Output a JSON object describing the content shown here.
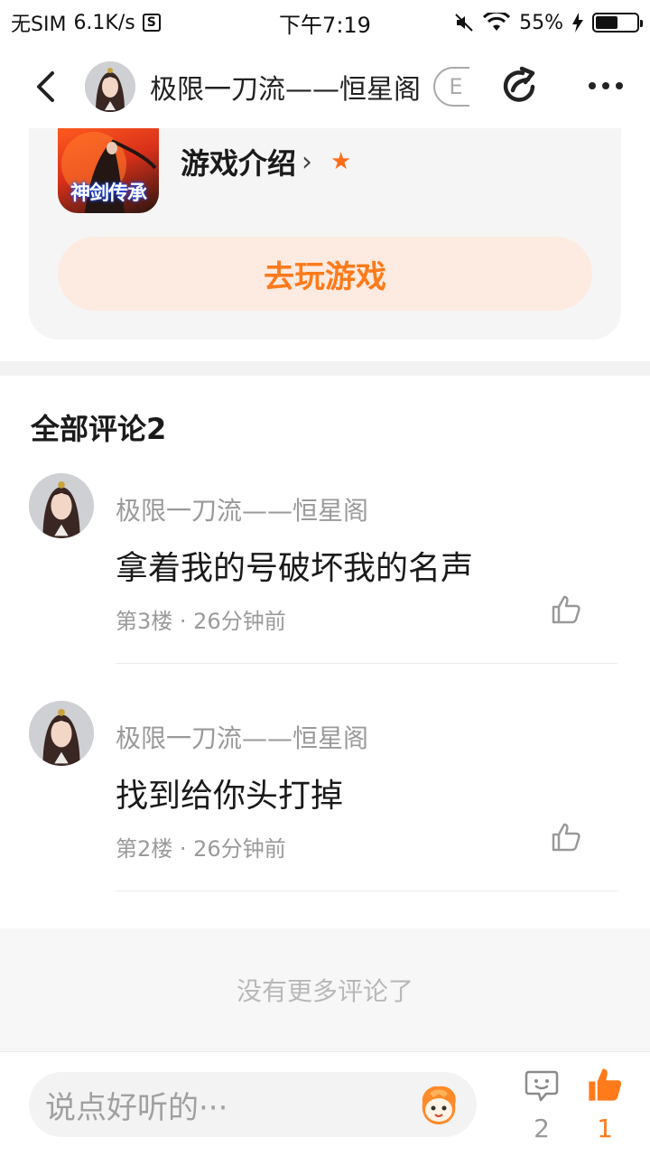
{
  "status_bar": {
    "carrier": "无SIM",
    "speed": "6.1K/s",
    "s_badge": "S",
    "time": "下午7:19",
    "battery": "55%"
  },
  "nav": {
    "title": "极限一刀流——恒星阁",
    "chip": "E"
  },
  "game": {
    "icon_text": "神剑传承",
    "intro_label": "游戏介绍",
    "play_label": "去玩游戏",
    "accent_color": "#ff7a1a"
  },
  "comments_header": "全部评论2",
  "comments": [
    {
      "name": "极限一刀流——恒星阁",
      "text": "拿着我的号破坏我的名声",
      "meta": "第3楼 · 26分钟前"
    },
    {
      "name": "极限一刀流——恒星阁",
      "text": "找到给你头打掉",
      "meta": "第2楼 · 26分钟前"
    }
  ],
  "no_more": "没有更多评论了",
  "bottom": {
    "placeholder": "说点好听的···",
    "comment_count": "2",
    "like_count": "1"
  }
}
